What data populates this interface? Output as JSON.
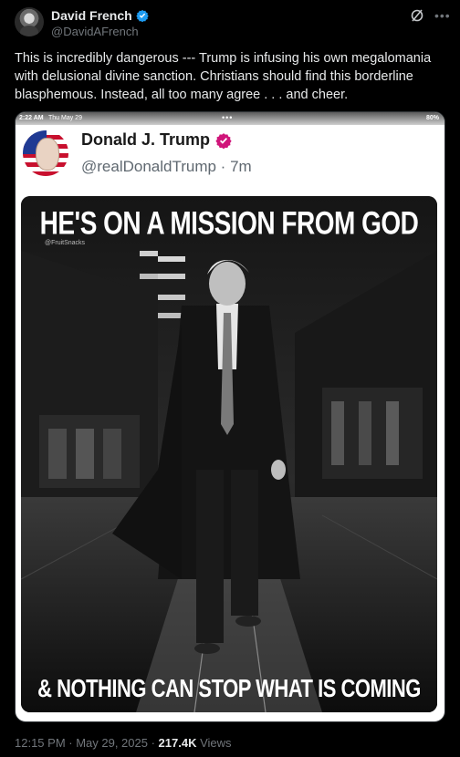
{
  "author": {
    "display_name": "David French",
    "handle": "@DavidAFrench"
  },
  "tweet": {
    "text": "This is incredibly dangerous --- Trump is infusing his own megalomania with delusional divine sanction. Christians should find this borderline blasphemous. Instead, all too many agree . . . and cheer."
  },
  "embedded": {
    "status_time": "2:22 AM",
    "status_date": "Thu May 29",
    "status_dots": "•••",
    "status_battery": "80%",
    "name": "Donald J. Trump",
    "handle_line": "@realDonaldTrump · 7m",
    "headline": "HE'S ON A MISSION FROM GOD",
    "watermark": "@FruitSnacks",
    "footer": "& NOTHING CAN STOP WHAT IS COMING"
  },
  "meta": {
    "timestamp": "12:15 PM · May 29, 2025 · ",
    "views_count": "217.4K",
    "views_label": " Views"
  },
  "colors": {
    "accent_verified": "#1d9bf0",
    "inner_badge": "#d0157a",
    "secondary_text": "#71767b"
  },
  "icons": [
    "verified-badge-icon",
    "grok-icon",
    "more-icon"
  ]
}
